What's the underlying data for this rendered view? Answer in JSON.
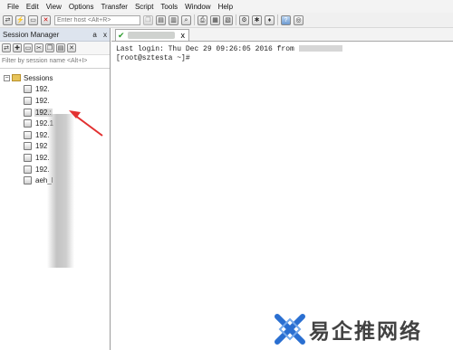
{
  "menu": [
    "File",
    "Edit",
    "View",
    "Options",
    "Transfer",
    "Script",
    "Tools",
    "Window",
    "Help"
  ],
  "toolbar": {
    "host_placeholder": "Enter host <Alt+R>"
  },
  "session_manager": {
    "title": "Session Manager",
    "pin": "a",
    "close": "x",
    "filter_placeholder": "Filter by session name <Alt+I>",
    "root_label": "Sessions",
    "sessions": [
      "192.",
      "192.",
      "192.:",
      "192.1",
      "192.",
      "192",
      "192.",
      "192.",
      "aeh_l"
    ]
  },
  "tab": {
    "close": "x"
  },
  "terminal": {
    "line1": "Last login: Thu Dec 29 09:26:05 2016 from ",
    "line2": "[root@sztesta ~]# "
  },
  "watermark": {
    "text": "易企推网络"
  },
  "colors": {
    "arrow": "#e23030",
    "status_ok": "#2b9a2b"
  }
}
